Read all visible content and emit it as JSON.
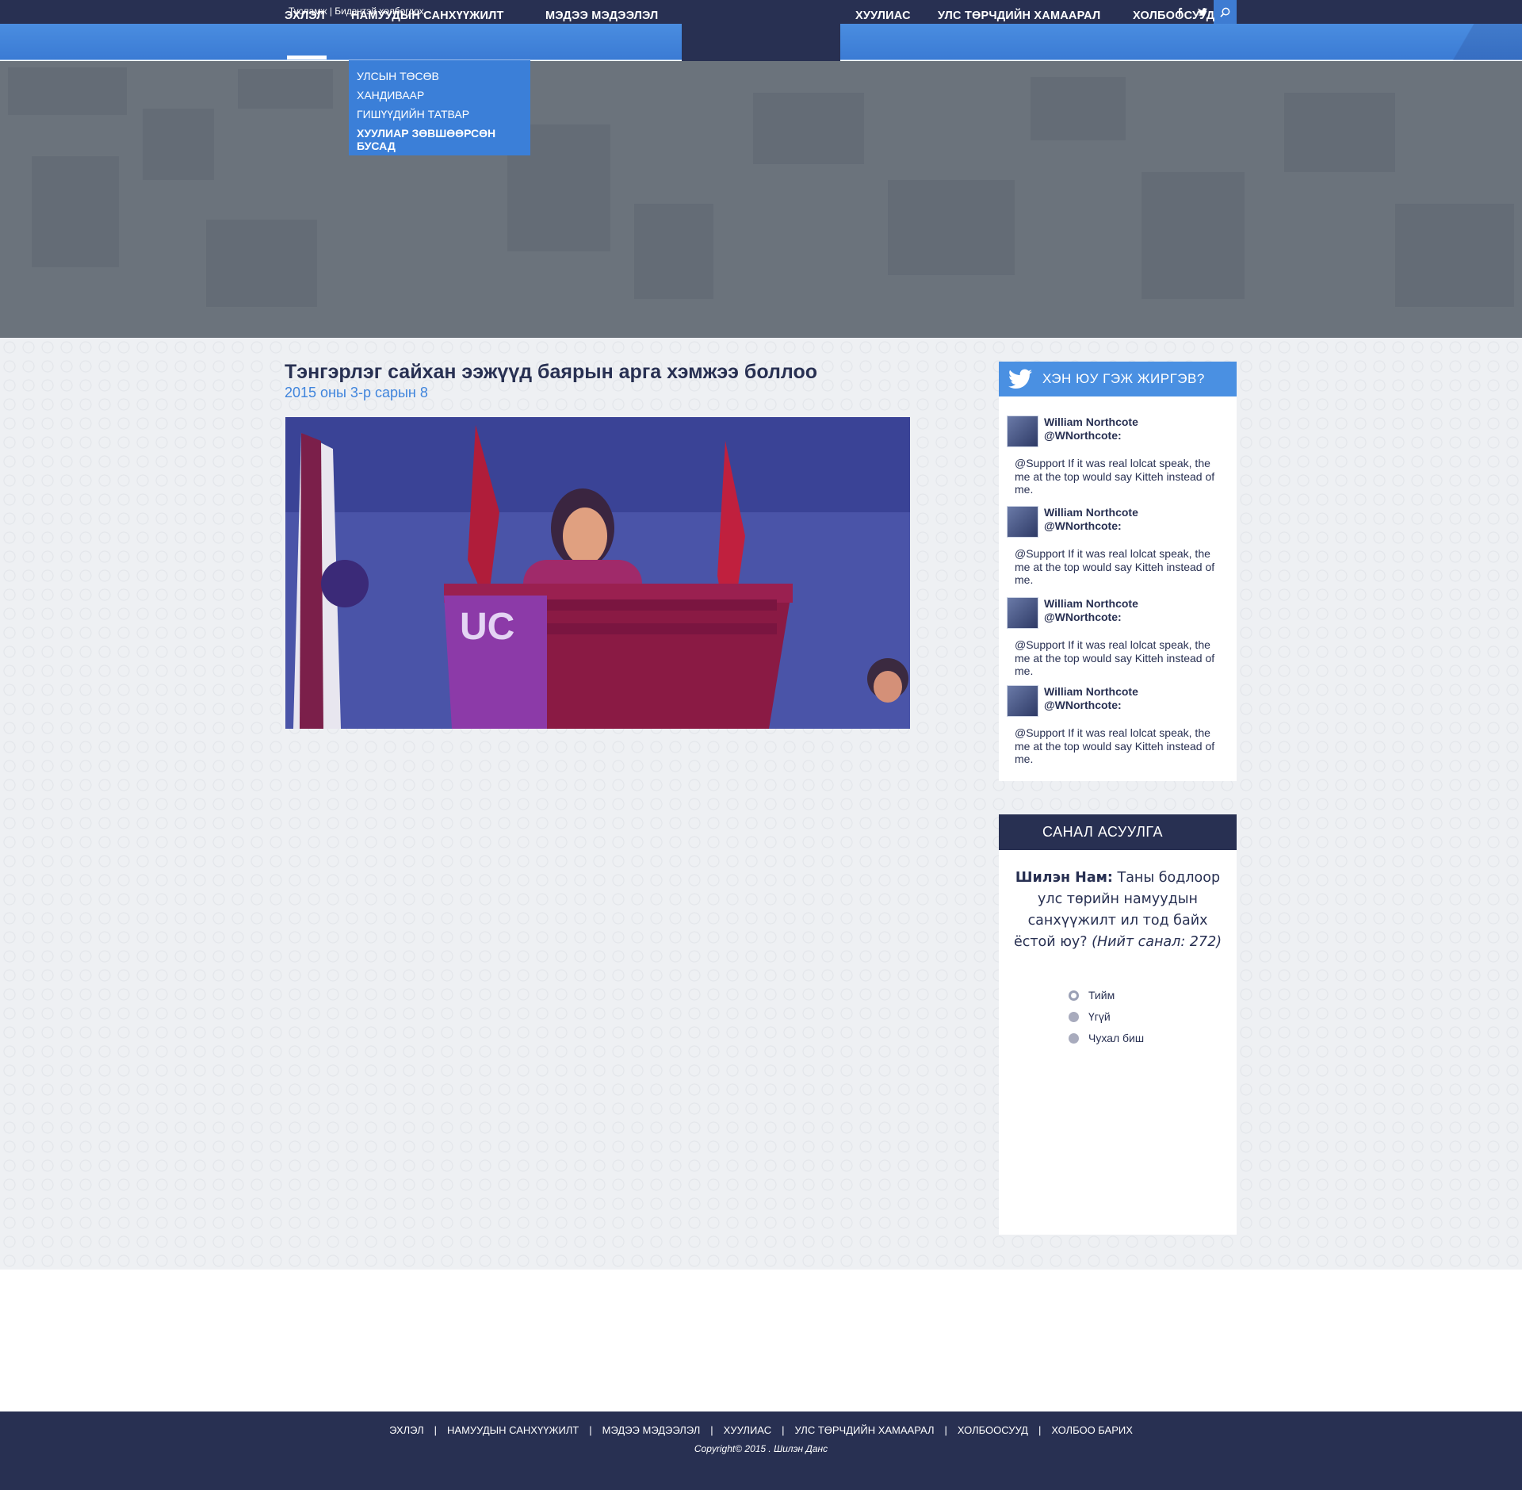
{
  "top_bar": {
    "help_link": "Тусламж",
    "divider": "|",
    "contact_link": "Бидэнтэй холбогдох",
    "social": {
      "facebook": "f",
      "twitter": "t",
      "search_icon": "search-icon"
    }
  },
  "nav": {
    "left": [
      "ЭХЛЭЛ",
      "НАМУУДЫН САНХҮҮЖИЛТ",
      "МЭДЭЭ МЭДЭЭЛЭЛ"
    ],
    "right": [
      "ХУУЛИАС",
      "УЛС ТӨРЧДИЙН ХАМААРАЛ",
      "ХОЛБООСУУД"
    ],
    "active": "ЭХЛЭЛ",
    "dropdown": [
      "УЛСЫН ТӨСӨВ",
      "ХАНДИВААР",
      "ГИШҮҮДИЙН ТАТВАР",
      "ХУУЛИАР ЗӨВШӨӨРСӨН БУСАД"
    ]
  },
  "article": {
    "title": "Тэнгэрлэг сайхан ээжүүд баярын арга хэмжээ боллоо",
    "date": "2015 оны 3-р сарын 8"
  },
  "twitter": {
    "title": "ХЭН ЮУ ГЭЖ ЖИРГЭВ?",
    "tweets": [
      {
        "name": "William Northcote",
        "handle": "@WNorthcote:",
        "text": "@Support If it was real lolcat speak, the me at the top would say Kitteh instead of me."
      },
      {
        "name": "William Northcote",
        "handle": "@WNorthcote:",
        "text": "@Support If it was real lolcat speak, the me at the top would say Kitteh instead of me."
      },
      {
        "name": "William Northcote",
        "handle": "@WNorthcote:",
        "text": "@Support If it was real lolcat speak, the me at the top would say Kitteh instead of me."
      },
      {
        "name": "William Northcote",
        "handle": "@WNorthcote:",
        "text": "@Support If it was real lolcat speak, the me at the top would say Kitteh instead of me."
      }
    ]
  },
  "poll": {
    "title": "САНАЛ АСУУЛГА",
    "lead": "Шилэн Нам:",
    "question": "Таны бодлоор улс төрийн намуудын санхүүжилт ил тод байх ёстой юу?",
    "total": "(Нийт санал: 272)",
    "options": [
      "Тийм",
      "Үгүй",
      "Чухал биш"
    ],
    "selected": "Тийм"
  },
  "footer": {
    "links": [
      "ЭХЛЭЛ",
      "НАМУУДЫН САНХҮҮЖИЛТ",
      "МЭДЭЭ МЭДЭЭЛЭЛ",
      "ХУУЛИАС",
      "УЛС ТӨРЧДИЙН ХАМААРАЛ",
      "ХОЛБООСУУД",
      "ХОЛБОО БАРИХ"
    ],
    "separator": "|",
    "copyright": "Copyright© 2015 . Шилэн Данс"
  },
  "colors": {
    "navy": "#283052",
    "blue": "#3e7cd2",
    "date_blue": "#3f84dc",
    "twitter_blue": "#4a90e2"
  }
}
